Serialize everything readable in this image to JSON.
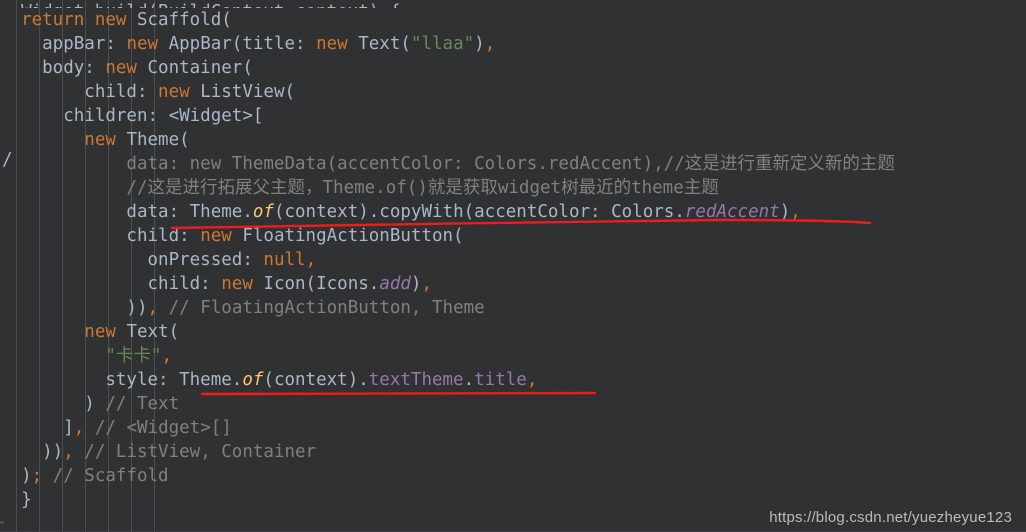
{
  "app": {
    "kind": "code-editor",
    "theme": "darcula",
    "background": "#2f3133",
    "default_text_color": "#a9b7c6"
  },
  "palette": {
    "keyword": "#cc7832",
    "string": "#6a8759",
    "comment": "#808080",
    "field": "#9876aa",
    "method_italic": "#ffc66d",
    "plain": "#a9b7c6",
    "annotation_red": "#ee1c1c",
    "indent_guide": "#4b4f51"
  },
  "code": {
    "language": "dart",
    "lines": [
      {
        "id": "line-0-clipped",
        "indent": 0,
        "clipped": true,
        "tokens": [
          {
            "t": "  Widget build(BuildContext context) {",
            "c": "plain"
          }
        ]
      },
      {
        "id": "line-return-scaffold",
        "tokens": [
          {
            "t": "  ",
            "c": "plain"
          },
          {
            "t": "return",
            "c": "kw"
          },
          {
            "t": " ",
            "c": "plain"
          },
          {
            "t": "new",
            "c": "kw"
          },
          {
            "t": " Scaffold(",
            "c": "plain"
          }
        ]
      },
      {
        "id": "line-appbar",
        "tokens": [
          {
            "t": "    appBar: ",
            "c": "plain"
          },
          {
            "t": "new",
            "c": "kw"
          },
          {
            "t": " AppBar(title: ",
            "c": "plain"
          },
          {
            "t": "new",
            "c": "kw"
          },
          {
            "t": " Text(",
            "c": "plain"
          },
          {
            "t": "\"llaa\"",
            "c": "str"
          },
          {
            "t": ")",
            "c": "plain"
          },
          {
            "t": ",",
            "c": "comma"
          }
        ]
      },
      {
        "id": "line-body-container",
        "tokens": [
          {
            "t": "    body: ",
            "c": "plain"
          },
          {
            "t": "new",
            "c": "kw"
          },
          {
            "t": " Container(",
            "c": "plain"
          }
        ]
      },
      {
        "id": "line-child-listview",
        "tokens": [
          {
            "t": "        child: ",
            "c": "plain"
          },
          {
            "t": "new",
            "c": "kw"
          },
          {
            "t": " ListView(",
            "c": "plain"
          }
        ]
      },
      {
        "id": "line-children",
        "tokens": [
          {
            "t": "      children: <Widget>[",
            "c": "plain"
          }
        ]
      },
      {
        "id": "line-new-theme",
        "tokens": [
          {
            "t": "        ",
            "c": "plain"
          },
          {
            "t": "new",
            "c": "kw"
          },
          {
            "t": " Theme(",
            "c": "plain"
          }
        ]
      },
      {
        "id": "line-themedata-commented",
        "tokens": [
          {
            "t": "            data: new ThemeData(accentColor: Colors.redAccent),//这是进行重新定义新的主题",
            "c": "cmt"
          }
        ]
      },
      {
        "id": "line-comment-parent-theme",
        "tokens": [
          {
            "t": "            //这是进行拓展父主题，Theme.of()就是获取widget树最近的theme主题",
            "c": "cmt"
          }
        ]
      },
      {
        "id": "line-data-copywith",
        "tokens": [
          {
            "t": "            data: Theme.",
            "c": "plain"
          },
          {
            "t": "of",
            "c": "mth"
          },
          {
            "t": "(context).copyWith(accentColor: Colors.",
            "c": "plain"
          },
          {
            "t": "redAccent",
            "c": "fldi"
          },
          {
            "t": ")",
            "c": "plain"
          },
          {
            "t": ",",
            "c": "comma"
          }
        ]
      },
      {
        "id": "line-child-fab",
        "tokens": [
          {
            "t": "            child: ",
            "c": "plain"
          },
          {
            "t": "new",
            "c": "kw"
          },
          {
            "t": " FloatingActionButton(",
            "c": "plain"
          }
        ]
      },
      {
        "id": "line-onpressed-null",
        "tokens": [
          {
            "t": "              onPressed: ",
            "c": "plain"
          },
          {
            "t": "null",
            "c": "kw"
          },
          {
            "t": ",",
            "c": "comma"
          }
        ]
      },
      {
        "id": "line-child-icon-add",
        "tokens": [
          {
            "t": "              child: ",
            "c": "plain"
          },
          {
            "t": "new",
            "c": "kw"
          },
          {
            "t": " Icon(Icons.",
            "c": "plain"
          },
          {
            "t": "add",
            "c": "fldi"
          },
          {
            "t": ")",
            "c": "plain"
          },
          {
            "t": ",",
            "c": "comma"
          }
        ]
      },
      {
        "id": "line-close-fab",
        "tokens": [
          {
            "t": "            ))",
            "c": "plain"
          },
          {
            "t": ",",
            "c": "comma"
          },
          {
            "t": " // FloatingActionButton, Theme",
            "c": "cmt"
          }
        ]
      },
      {
        "id": "line-new-text",
        "tokens": [
          {
            "t": "        ",
            "c": "plain"
          },
          {
            "t": "new",
            "c": "kw"
          },
          {
            "t": " Text(",
            "c": "plain"
          }
        ]
      },
      {
        "id": "line-text-string",
        "tokens": [
          {
            "t": "          ",
            "c": "plain"
          },
          {
            "t": "\"卡卡\"",
            "c": "str"
          },
          {
            "t": ",",
            "c": "comma"
          }
        ]
      },
      {
        "id": "line-style-texttheme",
        "tokens": [
          {
            "t": "          style: Theme.",
            "c": "plain"
          },
          {
            "t": "of",
            "c": "mth"
          },
          {
            "t": "(context).",
            "c": "plain"
          },
          {
            "t": "textTheme",
            "c": "fld"
          },
          {
            "t": ".",
            "c": "plain"
          },
          {
            "t": "title",
            "c": "fld"
          },
          {
            "t": ",",
            "c": "comma"
          }
        ]
      },
      {
        "id": "line-close-text",
        "tokens": [
          {
            "t": "        )",
            "c": "plain"
          },
          {
            "t": " // Text",
            "c": "cmt"
          }
        ]
      },
      {
        "id": "line-close-widget-array",
        "tokens": [
          {
            "t": "      ]",
            "c": "plain"
          },
          {
            "t": ",",
            "c": "comma"
          },
          {
            "t": " // <Widget>[]",
            "c": "cmt"
          }
        ]
      },
      {
        "id": "line-close-listview-container",
        "tokens": [
          {
            "t": "    ))",
            "c": "plain"
          },
          {
            "t": ",",
            "c": "comma"
          },
          {
            "t": " // ListView, Container",
            "c": "cmt"
          }
        ]
      },
      {
        "id": "line-close-scaffold",
        "tokens": [
          {
            "t": "  )",
            "c": "plain"
          },
          {
            "t": ";",
            "c": "comma"
          },
          {
            "t": " // Scaffold",
            "c": "cmt"
          }
        ]
      },
      {
        "id": "line-close-method",
        "tokens": [
          {
            "t": "  }",
            "c": "plain"
          }
        ]
      }
    ]
  },
  "gutter": {
    "stray_glyph": "/",
    "stray_glyph_color": "#a9b7c6"
  },
  "indent_guides_x": [
    16,
    39,
    62,
    85,
    108,
    131,
    154
  ],
  "annotations": [
    {
      "id": "underline-copywith",
      "kind": "freehand-underline",
      "color": "#ee1c1c",
      "note": "hand-drawn stroke under the data: Theme.of(context).copyWith(...) line"
    },
    {
      "id": "underline-text-close",
      "kind": "straight-underline",
      "color": "#ee1c1c",
      "note": "straight stroke under the ) // Text line"
    }
  ],
  "watermark": {
    "text": "https://blog.csdn.net/yuezheyue123"
  }
}
